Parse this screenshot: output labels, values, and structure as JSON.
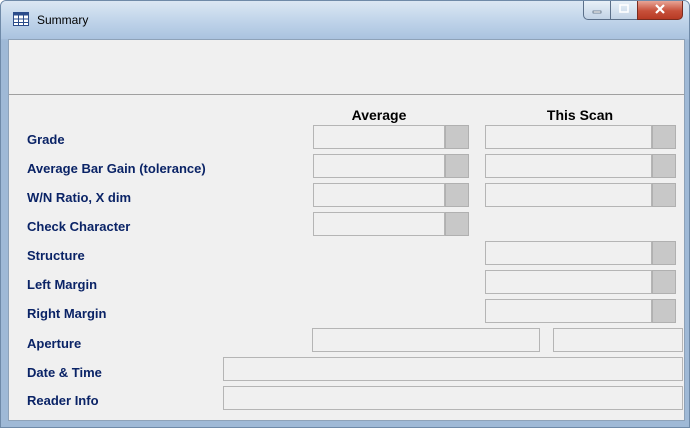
{
  "window": {
    "title": "Summary"
  },
  "columns": {
    "average": "Average",
    "this_scan": "This Scan"
  },
  "rows": [
    {
      "label": "Grade"
    },
    {
      "label": "Average Bar Gain (tolerance)"
    },
    {
      "label": "W/N Ratio, X dim"
    },
    {
      "label": "Check Character"
    },
    {
      "label": "Structure"
    },
    {
      "label": "Left Margin"
    },
    {
      "label": "Right Margin"
    },
    {
      "label": "Aperture"
    },
    {
      "label": "Date & Time"
    },
    {
      "label": "Reader Info"
    }
  ]
}
